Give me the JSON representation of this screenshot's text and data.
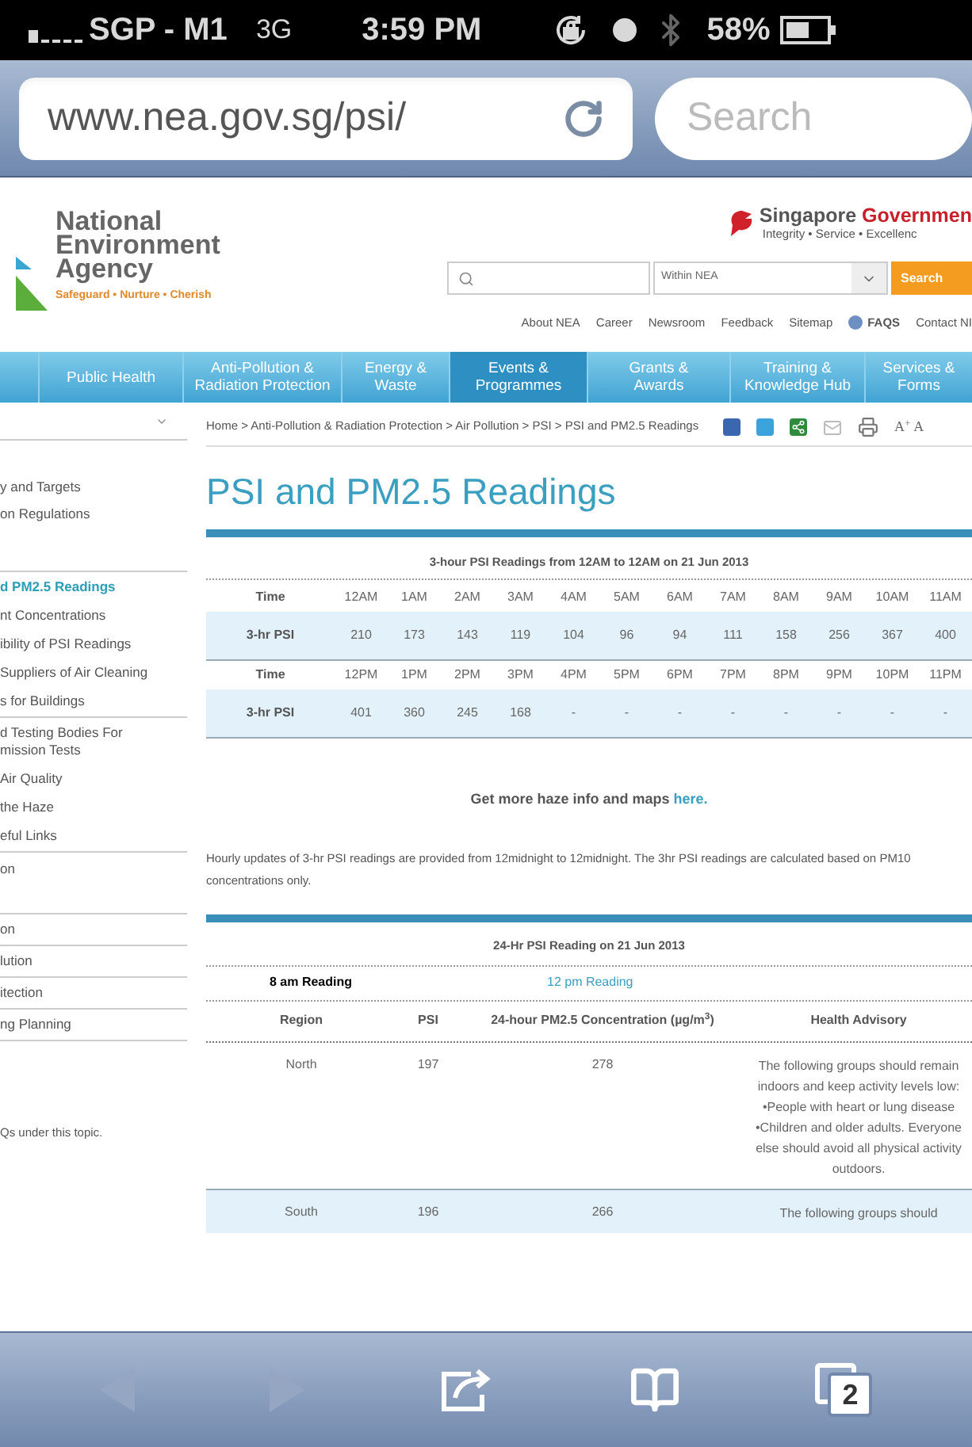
{
  "status_bar": {
    "carrier": "SGP - M1",
    "network": "3G",
    "time": "3:59 PM",
    "battery": "58%"
  },
  "browser": {
    "url": "www.nea.gov.sg/psi/",
    "search": {
      "placeholder": "Search"
    }
  },
  "header": {
    "logo_lines": [
      "National",
      "Environment",
      "Agency"
    ],
    "tagline": "Safeguard • Nurture • Cherish",
    "gov_name": "Singapore",
    "gov_name_accent": "Governmen",
    "gov_motto": "Integrity • Service • Excellenc",
    "search_scope": "Within NEA",
    "search_button": "Search",
    "links": [
      {
        "label": "About NEA",
        "kind": "plain"
      },
      {
        "label": "Career",
        "kind": "plain"
      },
      {
        "label": "Newsroom",
        "kind": "plain"
      },
      {
        "label": "Feedback",
        "kind": "plain"
      },
      {
        "label": "Sitemap",
        "kind": "plain"
      },
      {
        "label": "FAQS",
        "kind": "faq"
      },
      {
        "label": "Contact NI",
        "kind": "plain"
      }
    ]
  },
  "nav": [
    {
      "label": "Public Health",
      "selected": false
    },
    {
      "label": "Anti-Pollution &\nRadiation Protection",
      "selected": false
    },
    {
      "label": "Energy &\nWaste",
      "selected": false
    },
    {
      "label": "Events &\nProgrammes",
      "selected": true
    },
    {
      "label": "Grants &\nAwards",
      "selected": false
    },
    {
      "label": "Training &\nKnowledge Hub",
      "selected": false
    },
    {
      "label": "Services &\nForms",
      "selected": false
    }
  ],
  "sidebar": {
    "groups": [
      [
        {
          "label": "y and Targets",
          "selected": false
        },
        {
          "label": "on Regulations",
          "selected": false
        }
      ],
      [
        {
          "label": "d PM2.5 Readings",
          "selected": true
        },
        {
          "label": "nt Concentrations",
          "selected": false
        },
        {
          "label": "ibility of PSI Readings",
          "selected": false
        },
        {
          "label": "Suppliers of Air Cleaning",
          "selected": false
        },
        {
          "label": "s for Buildings",
          "selected": false
        }
      ],
      [
        {
          "label": "d Testing Bodies For\nmission Tests",
          "selected": false
        },
        {
          "label": "Air Quality",
          "selected": false
        },
        {
          "label": "the Haze",
          "selected": false
        },
        {
          "label": "eful Links",
          "selected": false
        }
      ],
      [
        {
          "label": "on",
          "selected": false
        }
      ],
      [
        {
          "label": "on",
          "selected": false
        }
      ],
      [
        {
          "label": "lution",
          "selected": false
        }
      ],
      [
        {
          "label": "itection",
          "selected": false
        }
      ],
      [
        {
          "label": "ng Planning",
          "selected": false
        }
      ]
    ],
    "note": "Qs under this topic."
  },
  "breadcrumb": "Home > Anti-Pollution & Radiation Protection > Air Pollution > PSI > PSI and PM2.5 Readings",
  "font_size_control": "A$^{+}$ A",
  "title": "PSI and PM2.5 Readings",
  "psi_table": {
    "caption": "3-hour PSI Readings from 12AM to 12AM on 21 Jun 2013",
    "rows": [
      {
        "kind": "time",
        "label": "Time",
        "cells": [
          "12AM",
          "1AM",
          "2AM",
          "3AM",
          "4AM",
          "5AM",
          "6AM",
          "7AM",
          "8AM",
          "9AM",
          "10AM",
          "11AM"
        ]
      },
      {
        "kind": "reading",
        "label": "3-hr PSI",
        "cells": [
          "210",
          "173",
          "143",
          "119",
          "104",
          "96",
          "94",
          "111",
          "158",
          "256",
          "367",
          "400"
        ]
      },
      {
        "kind": "time",
        "label": "Time",
        "cells": [
          "12PM",
          "1PM",
          "2PM",
          "3PM",
          "4PM",
          "5PM",
          "6PM",
          "7PM",
          "8PM",
          "9PM",
          "10PM",
          "11PM"
        ]
      },
      {
        "kind": "reading",
        "label": "3-hr PSI",
        "cells": [
          "401",
          "360",
          "245",
          "168",
          "-",
          "-",
          "-",
          "-",
          "-",
          "-",
          "-",
          "-"
        ]
      }
    ]
  },
  "haze_note": {
    "text": "Get more haze info and maps",
    "link": "here."
  },
  "update_note": "Hourly updates of 3-hr PSI readings are provided from 12midnight to 12midnight. The 3hr PSI readings are calculated based on PM10 concentrations only.",
  "daily_table": {
    "caption": "24-Hr PSI Reading on 21 Jun 2013",
    "tabs": [
      {
        "label": "8 am Reading",
        "selected": true
      },
      {
        "label": "12 pm Reading",
        "selected": false
      }
    ],
    "columns": [
      "Region",
      "PSI",
      "24-hour PM2.5 Concentration (µg/m$^{3}$)",
      "Health Advisory"
    ],
    "rows": [
      {
        "region": "North",
        "psi": "197",
        "pm25": "278",
        "advisory": "The following groups should remain indoors and keep activity levels low: •People with heart or lung disease •Children and older adults. Everyone else should avoid all physical activity outdoors."
      },
      {
        "region": "South",
        "psi": "196",
        "pm25": "266",
        "advisory": "The following groups should"
      }
    ]
  },
  "toolbar": [
    {
      "kind": "back",
      "disabled": true
    },
    {
      "kind": "forward",
      "disabled": true
    },
    {
      "kind": "share",
      "disabled": false
    },
    {
      "kind": "bookmarks",
      "disabled": false
    },
    {
      "kind": "tabs",
      "disabled": false,
      "count": "2"
    }
  ]
}
